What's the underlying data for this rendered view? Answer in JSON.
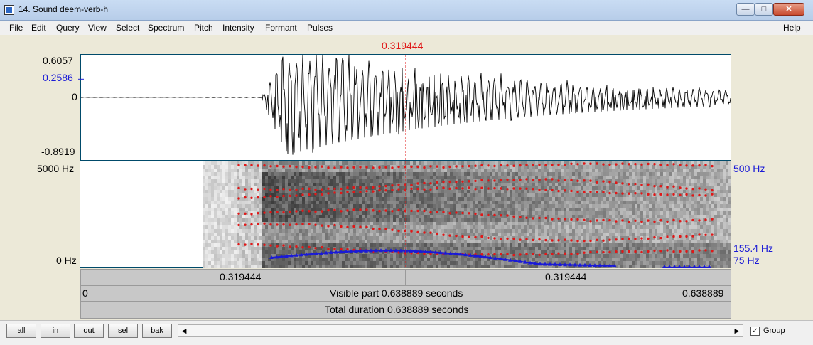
{
  "window": {
    "title": "14. Sound deem-verb-h",
    "min_glyph": "—",
    "max_glyph": "□",
    "close_glyph": "✕"
  },
  "menu": {
    "items": [
      "File",
      "Edit",
      "Query",
      "View",
      "Select",
      "Spectrum",
      "Pitch",
      "Intensity",
      "Formant",
      "Pulses"
    ],
    "help": "Help"
  },
  "cursor": {
    "time_label": "0.319444",
    "time": 0.319444,
    "color": "#e01818"
  },
  "waveform": {
    "max_label": "0.6057",
    "cursor_value_label": "0.2586",
    "zero_label": "0",
    "min_label": "-0.8919",
    "max": 0.6057,
    "min": -0.8919,
    "cursor_value": 0.2586
  },
  "spectrogram": {
    "top_label": "5000 Hz",
    "bottom_label": "0 Hz",
    "max_hz": 5000
  },
  "pitch": {
    "top_label": "500 Hz",
    "cursor_label": "155.4 Hz",
    "bottom_label": "75 Hz",
    "color": "#1a1ad6"
  },
  "formant_color": "#e01818",
  "bars": {
    "left_time": "0.319444",
    "right_time": "0.319444",
    "visible_start": "0",
    "visible_text": "Visible part 0.638889 seconds",
    "visible_end": "0.638889",
    "total_text": "Total duration 0.638889 seconds",
    "duration": 0.638889
  },
  "bottom": {
    "buttons": [
      "all",
      "in",
      "out",
      "sel",
      "bak"
    ],
    "scroll_left": "◀",
    "scroll_right": "▶",
    "group_label": "Group",
    "group_checked": true,
    "check_glyph": "✓"
  }
}
